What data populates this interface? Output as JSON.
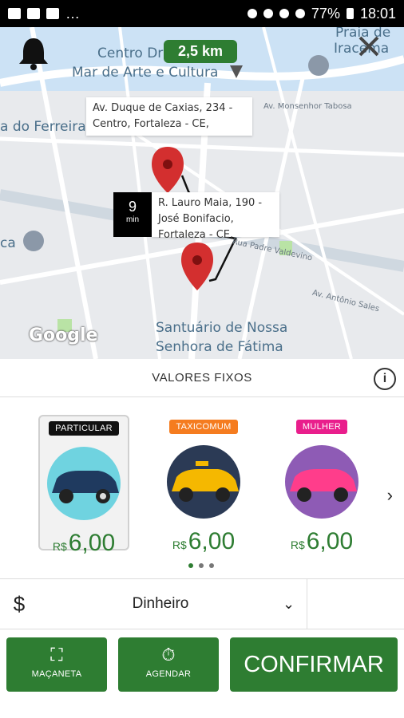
{
  "status_bar": {
    "battery": "77%",
    "time": "18:01"
  },
  "map": {
    "distance": "2,5 km",
    "labels": {
      "centro": "Centro Dragão do",
      "mar": "Mar de Arte e Cultura",
      "praia": "Praia de",
      "iracema": "Iracema",
      "ferreira": "a do Ferreira",
      "ca": "ca",
      "santuario1": "Santuário de Nossa",
      "santuario2": "Senhora de Fátima"
    },
    "streets": {
      "monsenhor": "Av. Monsenhor Tabosa",
      "padre": "Rua Padre Valdevino",
      "antonio": "Av. Antônio Sales"
    },
    "origin": "Av. Duque de Caxias, 234 - Centro, Fortaleza - CE,",
    "destination": "R. Lauro Maia, 190 - José Bonifacio, Fortaleza - CE,",
    "eta_value": "9",
    "eta_unit": "min",
    "google": "Google"
  },
  "section": {
    "title": "VALORES FIXOS",
    "info_icon": "i"
  },
  "categories": [
    {
      "label": "PARTICULAR",
      "currency": "R$",
      "price": "6,00",
      "badge_color": "#111111",
      "disc_color": "#6fd3e0",
      "car_color": "#1f3a5f"
    },
    {
      "label": "TAXICOMUM",
      "currency": "R$",
      "price": "6,00",
      "badge_color": "#f57c1f",
      "disc_color": "#2b3a55",
      "car_color": "#f5b800"
    },
    {
      "label": "MULHER",
      "currency": "R$",
      "price": "6,00",
      "badge_color": "#e91e8c",
      "disc_color": "#8e5bb5",
      "car_color": "#ff3d8b"
    }
  ],
  "payment": {
    "symbol": "$",
    "method": "Dinheiro"
  },
  "buttons": {
    "macaneta": "MAÇANETA",
    "agendar": "AGENDAR",
    "confirmar": "CONFIRMAR"
  },
  "colors": {
    "primary": "#2e7d32",
    "pin": "#d32f2f"
  }
}
